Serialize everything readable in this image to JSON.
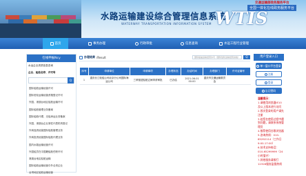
{
  "banner": {
    "title_cn": "水路运输建设综合管理信息系统",
    "title_en": "WATERWAY TRANSPORTATION INFORMATION SYSTEM",
    "logo": "WTIS",
    "slogan_top": "交通运输部政务服务平台",
    "slogan_bottom": "全国一体化在线政务服务平台"
  },
  "nav": {
    "items": [
      {
        "label": "首页",
        "icon": "home-icon"
      },
      {
        "label": "事务办理",
        "icon": "doc-icon"
      },
      {
        "label": "行政审批",
        "icon": "stamp-icon"
      },
      {
        "label": "信息查询",
        "icon": "search-icon"
      },
      {
        "label": "水运工程行业管理",
        "icon": "chart-icon"
      }
    ]
  },
  "sidebar": {
    "title": "在线申报Ncy",
    "top_link": "水运企业资质信息查询",
    "search_label": "企业、船舶名称、许可号",
    "search_placeholder": "",
    "search_button": "Q",
    "links": [
      "国际船舶运输经营许可",
      "国际班轮运输经营资格登记许可",
      "外国、港澳台地区船舶运输许可",
      "国际船舶管理业务备案",
      "国际船舶代理、无船承运业务备案",
      "外国、港澳台企业常驻代表机构登记",
      "外商独资经营国际船舶管理业务",
      "外商投资经营国际船舶代理业务",
      "国内水路运输经营许可",
      "外国船员在中国籍船舶任职许可",
      "港澳台地区船舶运输",
      "国际船舶运输经营中外合资企业",
      "台湾地区船舶运输经营"
    ]
  },
  "main": {
    "breadcrumb_label": "办理结果",
    "breadcrumb_path": "/Result",
    "search_placeholder": "国际船舶运输经营许可（国际班轮运输经营资格）",
    "search_button": "Q",
    "table": {
      "headers": [
        "序号",
        "申请单位",
        "申请事项",
        "办理状态",
        "办结时间",
        "办理部门",
        "许可证编号"
      ],
      "rows": [
        [
          "1",
          "重庆长江轮船公司北京分公司国际海运公司",
          "三峡枢纽船舶过闸申请审批",
          "已办结",
          "2021-06-01 00:00",
          "重庆市交通运输委员会",
          ""
        ]
      ]
    }
  },
  "right": {
    "title": "用户登录入口",
    "buttons": [
      {
        "label": "单一窗口平台登录",
        "style": "solid"
      },
      {
        "label": "注册",
        "style": "outline"
      },
      {
        "label": "登录",
        "style": "outline"
      },
      {
        "label": "忘记密码",
        "style": "solid"
      }
    ],
    "notice": [
      "温馨提示：",
      "1.请使用浏览器IE10及以上版本进行访问",
      "2.首次登录的用户请先注册",
      "3.若您在使用过程中遇到问题，请联系系统管理员",
      "4.推荐使用谷歌浏览器",
      "5.咨询热线：010-65292114（工作日9:00-17:00）",
      "6.技术支持电话：010-65299999（24小时值守）",
      "7.其他服务请拨打12328服务监督热线"
    ]
  },
  "colors": {
    "primary": "#2b71c6",
    "nav_active": "#2ea6ec",
    "notice": "#d2141c"
  }
}
